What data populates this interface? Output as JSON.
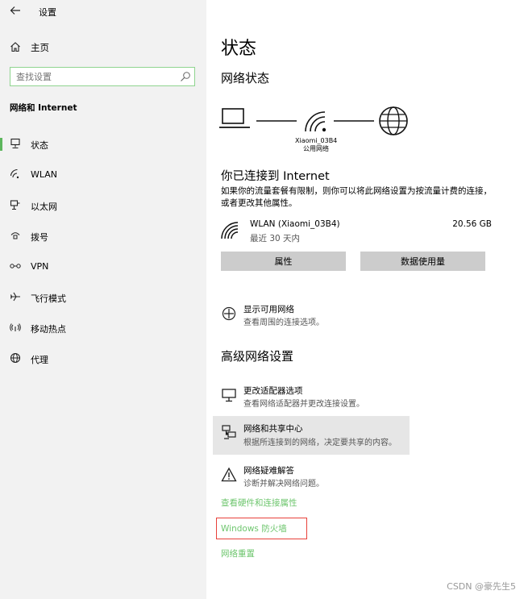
{
  "window": {
    "title": "设置",
    "back_icon": "back-arrow-icon"
  },
  "sidebar": {
    "home_label": "主页",
    "search_placeholder": "查找设置",
    "section_title": "网络和 Internet",
    "items": [
      {
        "label": "状态",
        "icon": "status-icon",
        "active": true
      },
      {
        "label": "WLAN",
        "icon": "wifi-icon",
        "active": false
      },
      {
        "label": "以太网",
        "icon": "ethernet-icon",
        "active": false
      },
      {
        "label": "拨号",
        "icon": "dialup-icon",
        "active": false
      },
      {
        "label": "VPN",
        "icon": "vpn-icon",
        "active": false
      },
      {
        "label": "飞行模式",
        "icon": "airplane-icon",
        "active": false
      },
      {
        "label": "移动热点",
        "icon": "hotspot-icon",
        "active": false
      },
      {
        "label": "代理",
        "icon": "proxy-globe-icon",
        "active": false
      }
    ]
  },
  "main": {
    "page_title": "状态",
    "network_status_heading": "网络状态",
    "ssid": "Xiaomi_03B4",
    "network_type": "公用网络",
    "connected_title": "你已连接到 Internet",
    "connected_desc": "如果你的流量套餐有限制，则你可以将此网络设置为按流量计费的连接，或者更改其他属性。",
    "wlan": {
      "name": "WLAN (Xiaomi_03B4)",
      "sub": "最近 30 天内",
      "usage": "20.56 GB"
    },
    "buttons": {
      "properties": "属性",
      "data_usage": "数据使用量"
    },
    "show_networks": {
      "title": "显示可用网络",
      "sub": "查看周围的连接选项。"
    },
    "advanced_heading": "高级网络设置",
    "advanced_items": [
      {
        "title": "更改适配器选项",
        "sub": "查看网络适配器并更改连接设置。"
      },
      {
        "title": "网络和共享中心",
        "sub": "根据所连接到的网络，决定要共享的内容。"
      },
      {
        "title": "网络疑难解答",
        "sub": "诊断并解决网络问题。"
      }
    ],
    "links": {
      "hardware": "查看硬件和连接属性",
      "firewall": "Windows 防火墙",
      "reset": "网络重置"
    }
  },
  "watermark": "CSDN @豪先生5",
  "colors": {
    "accent": "#5db65d",
    "link": "#6ec66e",
    "highlight_box": "#e8403a",
    "sidebar_bg": "#f2f2f2"
  }
}
